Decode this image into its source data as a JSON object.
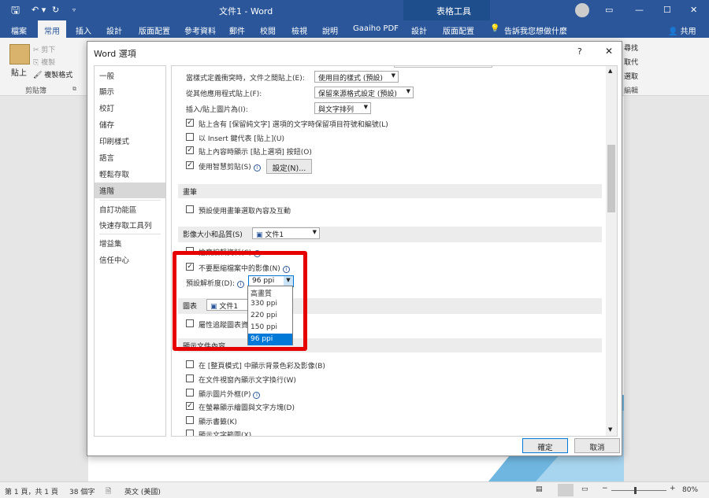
{
  "titlebar": {
    "doc_title": "文件1 - Word",
    "context_tab": "表格工具",
    "window_controls": [
      "—",
      "☐",
      "✕"
    ]
  },
  "ribbon": {
    "tabs": [
      "檔案",
      "常用",
      "插入",
      "設計",
      "版面配置",
      "參考資料",
      "郵件",
      "校閱",
      "檢視",
      "說明",
      "Gaaiho PDF",
      "設計",
      "版面配置"
    ],
    "active_tab": "常用",
    "tell_me": "告訴我您想做什麼",
    "share": "共用",
    "clipboard": {
      "cut": "剪下",
      "copy": "複製",
      "paste": "貼上",
      "format_painter": "複製格式",
      "group": "剪貼簿"
    },
    "editing": {
      "find": "尋找",
      "replace": "取代",
      "select": "選取",
      "group": "編輯"
    }
  },
  "dialog": {
    "title": "Word 選項",
    "help": "?",
    "close": "✕",
    "nav": [
      "一般",
      "顯示",
      "校訂",
      "儲存",
      "印刷樣式",
      "語言",
      "輕鬆存取",
      "進階",
      "自訂功能區",
      "快速存取工具列",
      "增益集",
      "信任中心"
    ],
    "nav_selected": "進階",
    "cut_copy_paste": {
      "style_conflict_label": "當樣式定義衝突時，文件之間貼上(E):",
      "style_conflict_value": "使用目的樣式 (預設)",
      "other_apps_label": "從其他應用程式貼上(F):",
      "other_apps_value": "保留來源格式設定 (預設)",
      "insert_picture_label": "插入/貼上圖片為(I):",
      "insert_picture_value": "與文字排列",
      "keep_bullets": "貼上含有 [保留純文字] 選項的文字時保留項目符號和編號(L)",
      "use_insert_key": "以 Insert 鍵代表 [貼上](U)",
      "show_paste_options": "貼上內容時顯示 [貼上選項] 按鈕(O)",
      "smart_cut_paste": "使用智慧剪貼(S)",
      "settings_button": "設定(N)..."
    },
    "pen": {
      "header": "畫筆",
      "default_pen": "預設使用畫筆選取內容及互動"
    },
    "image_size": {
      "header": "影像大小和品質(S)",
      "doc": "文件1",
      "discard_edit": "捨棄編輯資料(C)",
      "no_compress": "不要壓縮檔案中的影像(N)",
      "resolution_label": "預設解析度(D):",
      "resolution_value": "96 ppi",
      "resolution_options": [
        "高畫質",
        "330 ppi",
        "220 ppi",
        "150 ppi",
        "96 ppi"
      ]
    },
    "chart": {
      "header": "圖表",
      "doc": "文件1",
      "track_properties": "屬性追蹤圖表資料點"
    },
    "show_doc_content": {
      "header": "顯示文件內容",
      "items": [
        "在 [整頁模式] 中顯示背景色彩及影像(B)",
        "在文件視窗內顯示文字換行(W)",
        "顯示圖片外框(P)",
        "在螢幕顯示繪圖與文字方塊(D)",
        "顯示書籤(K)",
        "顯示文字範圍(X)"
      ]
    },
    "ok": "確定",
    "cancel": "取消"
  },
  "statusbar": {
    "page": "第 1 頁，共 1 頁",
    "words": "38 個字",
    "language": "英文 (美國)",
    "zoom": "80%"
  }
}
